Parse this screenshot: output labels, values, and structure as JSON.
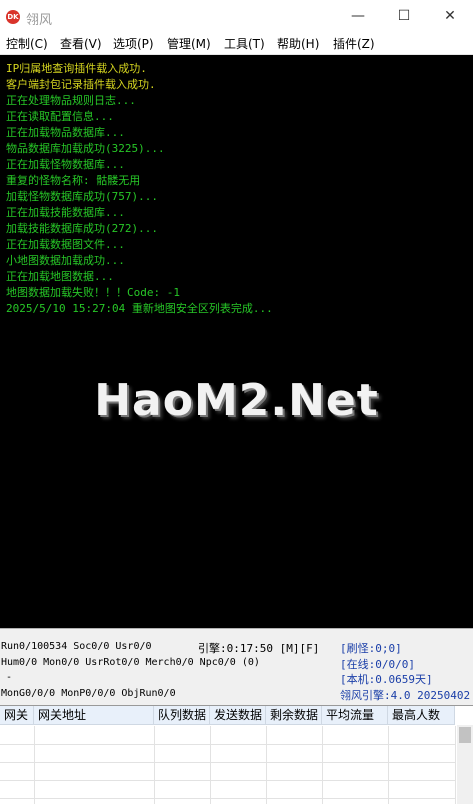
{
  "window": {
    "title": "翎风",
    "app_icon_text": "DK",
    "minimize": "—",
    "maximize": "☐",
    "close": "✕"
  },
  "menu": [
    "控制(C)",
    "查看(V)",
    "选项(P)",
    "管理(M)",
    "工具(T)",
    "帮助(H)",
    "插件(Z)"
  ],
  "log_lines": [
    "IP归属地查询插件载入成功.",
    "客户端封包记录插件载入成功.",
    "正在处理物品规则日志...",
    "正在读取配置信息...",
    "正在加载物品数据库...",
    "物品数据库加载成功(3225)...",
    "正在加载怪物数据库...",
    "重复的怪物名称: 骷髅无用",
    "加载怪物数据库成功(757)...",
    "正在加载技能数据库...",
    "加载技能数据库成功(272)...",
    "正在加载数据图文件...",
    "小地图数据加载成功...",
    "正在加载地图数据...",
    "地图数据加载失败！！！Code: -1",
    "2025/5/10 15:27:04 重新地图安全区列表完成..."
  ],
  "watermark": "HaoM2.Net",
  "status": {
    "run": "Run0/100534 Soc0/0 Usr0/0",
    "hum": "Hum0/0 Mon0/0 UsrRot0/0 Merch0/0 Npc0/0 (0)",
    "dash": "-",
    "mon": "MonG0/0/0 MonP0/0/0 ObjRun0/0",
    "engine_time": "引擎:0:17:50 [M][F]",
    "refresh": "[刷怪:0;0]",
    "online": "[在线:0/0/0]",
    "local": "[本机:0.0659天]",
    "version": "翎风引擎:4.0 20250402"
  },
  "grid": {
    "headers": [
      "网关",
      "网关地址",
      "队列数据",
      "发送数据",
      "剩余数据",
      "平均流量",
      "最高人数"
    ]
  },
  "colors": {
    "console_bg": "#000000",
    "log_green": "#27c727",
    "log_yellow": "#d6d620",
    "status_blue": "#1a3ea8",
    "grid_header_bg": "#e8f0fa"
  }
}
